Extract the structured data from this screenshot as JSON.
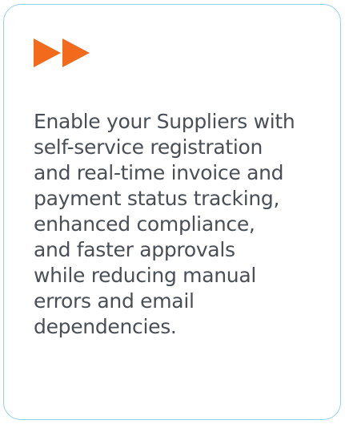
{
  "card": {
    "icon": "fast-forward-icon",
    "accent_color": "#f26b1d",
    "border_color": "#8fd3e8",
    "text_color": "#4a4f56",
    "description": "Enable your Suppliers with\nself-service registration\nand real-time invoice and\npayment status tracking,\nenhanced compliance,\nand faster approvals\nwhile reducing manual\nerrors and email\ndependencies."
  }
}
